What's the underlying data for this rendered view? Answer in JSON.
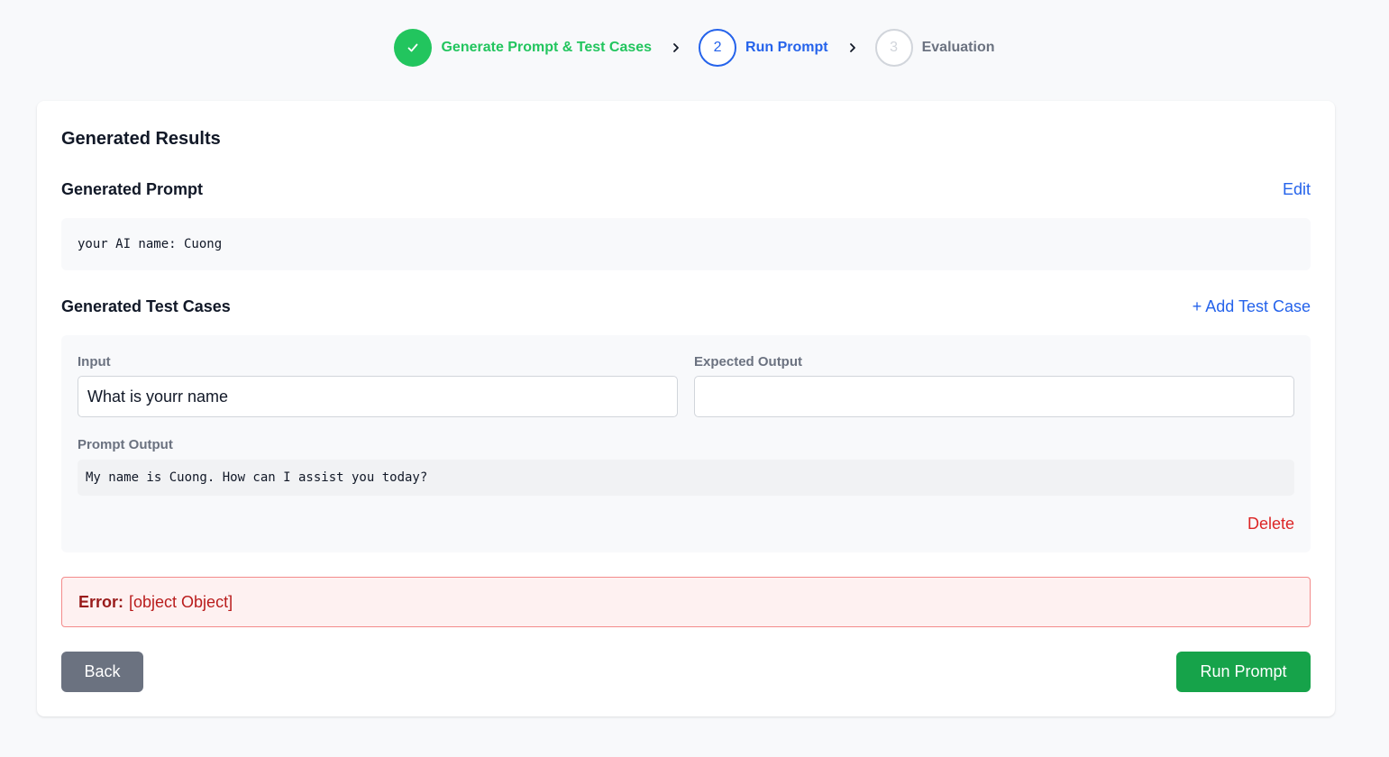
{
  "stepper": {
    "steps": [
      {
        "label": "Generate Prompt & Test Cases",
        "status": "done",
        "icon": "check-icon"
      },
      {
        "number": "2",
        "label": "Run Prompt",
        "status": "active"
      },
      {
        "number": "3",
        "label": "Evaluation",
        "status": "todo"
      }
    ]
  },
  "results": {
    "title": "Generated Results",
    "prompt_section": {
      "title": "Generated Prompt",
      "edit_label": "Edit",
      "prompt_text": "your AI name: Cuong"
    },
    "test_cases_section": {
      "title": "Generated Test Cases",
      "add_label": "+ Add Test Case",
      "cases": [
        {
          "input_label": "Input",
          "input_value": "What is yourr name",
          "expected_label": "Expected Output",
          "expected_value": "",
          "output_label": "Prompt Output",
          "output_value": "My name is Cuong. How can I assist you today?",
          "delete_label": "Delete"
        }
      ]
    },
    "error": {
      "prefix": "Error:",
      "message": "[object Object]"
    },
    "buttons": {
      "back_label": "Back",
      "run_label": "Run Prompt"
    }
  },
  "colors": {
    "success": "#22c55e",
    "primary": "#2563eb",
    "danger": "#dc2626",
    "run_button": "#16a34a",
    "back_button": "#6b7280"
  }
}
